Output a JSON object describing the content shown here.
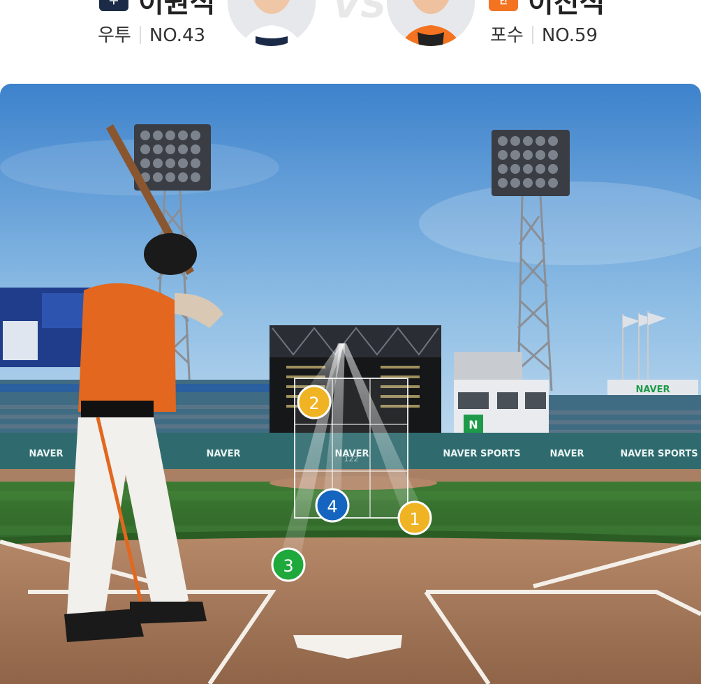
{
  "batter": {
    "name": "이원석",
    "team_logo_text": "두",
    "team_color": "#1b2a47",
    "position": "우투",
    "number": "NO.43"
  },
  "pitcher": {
    "name": "이진석",
    "team_logo_text": "한",
    "team_color": "#f37321",
    "position": "포수",
    "number": "NO.59"
  },
  "vs_label": "VS",
  "scene": {
    "pitch_speed_label": "122",
    "ad_banners": [
      "NAVER",
      "NAVER",
      "NAVER",
      "NAVER SPORTS",
      "NAVER",
      "NAVER SPORTS"
    ],
    "scoreboard_label": "NAVER",
    "n_logo": "N"
  },
  "pitches": [
    {
      "number": "1",
      "color": "#f0b323"
    },
    {
      "number": "2",
      "color": "#f0b323"
    },
    {
      "number": "3",
      "color": "#1fa83c"
    },
    {
      "number": "4",
      "color": "#1565c0"
    }
  ],
  "colors": {
    "sky_top": "#3f86cf",
    "sky_bottom": "#b8d6ee",
    "grass": "#2f6b2a",
    "dirt": "#a8795a",
    "strike_zone": "#ffffff"
  }
}
